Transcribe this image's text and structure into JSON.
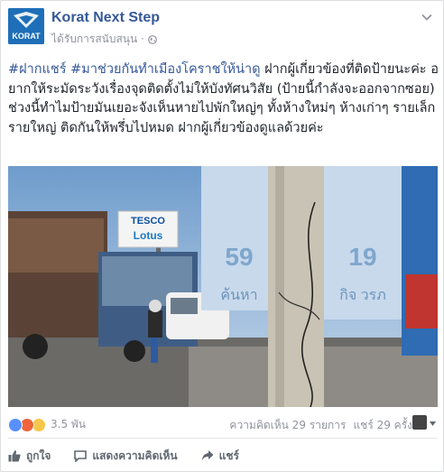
{
  "header": {
    "page_name": "Korat Next Step",
    "sponsored_label": "ได้รับการสนับสนุน · ",
    "avatar_text": "KORAT"
  },
  "post": {
    "tag1": "#ฝากแชร์",
    "tag2": "#มาช่วยกันทำเมืองโคราชให้น่าดู",
    "body": " ฝากผู้เกี่ยวข้องที่ติดป้ายนะค่ะ อยากให้ระมัดระวังเรื่องจุดติดตั้งไม่ให้บังทัศนวิสัย (ป้ายนี้กำลังจะออกจากซอย) ช่วงนี้ทำไมป้ายมันเยอะจังเห็นหายไปพักใหญ่ๆ ทั้งห้างใหม่ๆ ห้างเก่าๆ รายเล็กรายใหญ่ ติดกันให้พรึ่บไปหมด ฝากผู้เกี่ยวข้องดูแลด้วยค่ะ"
  },
  "photo": {
    "store_sign_top": "TESCO",
    "store_sign_bottom": "Lotus",
    "banner_left_number": "59",
    "banner_left_text": "ค้นหา",
    "banner_right_number": "19",
    "banner_right_text": "กิจ วรภ"
  },
  "stats": {
    "reaction_count": "3.5 พัน",
    "comments": "ความคิดเห็น 29 รายการ",
    "shares": "แชร์ 29 ครั้ง"
  },
  "actions": {
    "like": "ถูกใจ",
    "comment": "แสดงความคิดเห็น",
    "share": "แชร์"
  },
  "colors": {
    "link": "#365899",
    "brand": "#1e6fb8",
    "muted": "#90949c"
  }
}
